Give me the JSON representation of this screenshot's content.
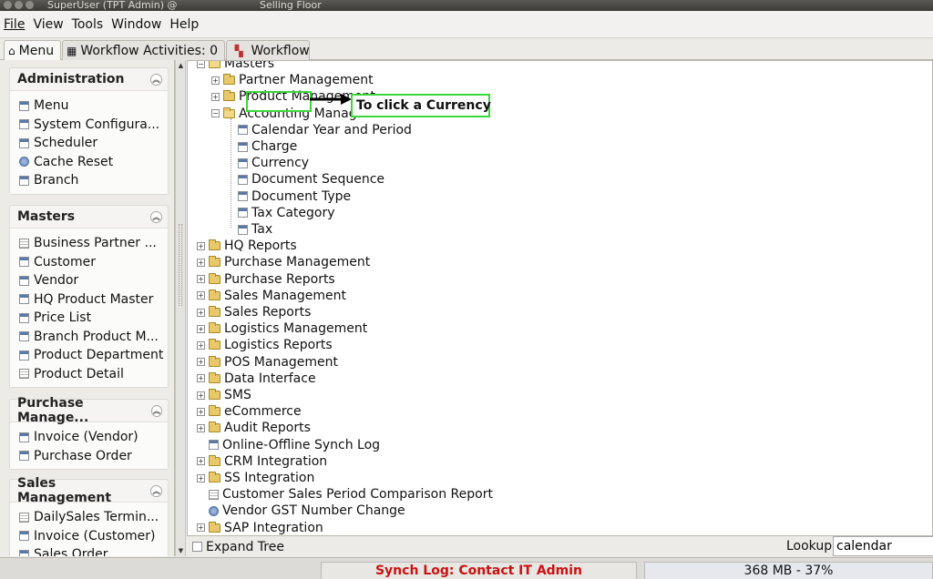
{
  "window": {
    "title": "SuperUser (TPT Admin) @",
    "title2": "Selling Floor"
  },
  "menubar": [
    "File",
    "View",
    "Tools",
    "Window",
    "Help"
  ],
  "tabs": [
    {
      "label": "Menu",
      "icon": "home-icon"
    },
    {
      "label": "Workflow Activities: 0",
      "icon": "table-icon"
    },
    {
      "label": "Workflow",
      "icon": "workflow-icon"
    }
  ],
  "sidebar": {
    "groups": [
      {
        "title": "Administration",
        "items": [
          {
            "label": "Menu",
            "icon": "window-icon"
          },
          {
            "label": "System Configura...",
            "icon": "window-icon"
          },
          {
            "label": "Scheduler",
            "icon": "window-icon"
          },
          {
            "label": "Cache Reset",
            "icon": "process-icon"
          },
          {
            "label": "Branch",
            "icon": "window-icon"
          }
        ]
      },
      {
        "title": "Masters",
        "items": [
          {
            "label": "Business Partner ...",
            "icon": "report-icon"
          },
          {
            "label": "Customer",
            "icon": "window-icon"
          },
          {
            "label": "Vendor",
            "icon": "window-icon"
          },
          {
            "label": "HQ Product Master",
            "icon": "window-icon"
          },
          {
            "label": "Price List",
            "icon": "window-icon"
          },
          {
            "label": "Branch Product M...",
            "icon": "window-icon"
          },
          {
            "label": "Product Department",
            "icon": "window-icon"
          },
          {
            "label": "Product Detail",
            "icon": "report-icon"
          }
        ]
      },
      {
        "title": "Purchase Manage...",
        "items": [
          {
            "label": "Invoice (Vendor)",
            "icon": "window-icon"
          },
          {
            "label": "Purchase Order",
            "icon": "window-icon"
          }
        ]
      },
      {
        "title": "Sales Management",
        "items": [
          {
            "label": "DailySales Termin...",
            "icon": "report-icon"
          },
          {
            "label": "Invoice (Customer)",
            "icon": "window-icon"
          },
          {
            "label": "Sales Order",
            "icon": "window-icon"
          }
        ]
      }
    ]
  },
  "tree": {
    "nodes": [
      {
        "label": "Masters",
        "type": "folder-open",
        "expander": "−"
      },
      {
        "label": "Partner Management",
        "type": "folder",
        "expander": "+"
      },
      {
        "label": "Product Management",
        "type": "folder",
        "expander": "+"
      },
      {
        "label": "Accounting Management",
        "type": "folder-open",
        "expander": "−"
      },
      {
        "label": "Calendar Year and Period",
        "type": "window"
      },
      {
        "label": "Charge",
        "type": "window"
      },
      {
        "label": "Currency",
        "type": "window"
      },
      {
        "label": "Document Sequence",
        "type": "window"
      },
      {
        "label": "Document Type",
        "type": "window"
      },
      {
        "label": "Tax Category",
        "type": "window"
      },
      {
        "label": "Tax",
        "type": "window"
      },
      {
        "label": "HQ Reports",
        "type": "folder",
        "expander": "+"
      },
      {
        "label": "Purchase Management",
        "type": "folder",
        "expander": "+"
      },
      {
        "label": "Purchase Reports",
        "type": "folder",
        "expander": "+"
      },
      {
        "label": "Sales Management",
        "type": "folder",
        "expander": "+"
      },
      {
        "label": "Sales Reports",
        "type": "folder",
        "expander": "+"
      },
      {
        "label": "Logistics Management",
        "type": "folder",
        "expander": "+"
      },
      {
        "label": "Logistics Reports",
        "type": "folder",
        "expander": "+"
      },
      {
        "label": "POS Management",
        "type": "folder",
        "expander": "+"
      },
      {
        "label": "Data Interface",
        "type": "folder",
        "expander": "+"
      },
      {
        "label": "SMS",
        "type": "folder",
        "expander": "+"
      },
      {
        "label": "eCommerce",
        "type": "folder",
        "expander": "+"
      },
      {
        "label": "Audit Reports",
        "type": "folder",
        "expander": "+"
      },
      {
        "label": "Online-Offline Synch Log",
        "type": "window"
      },
      {
        "label": "CRM Integration",
        "type": "folder",
        "expander": "+"
      },
      {
        "label": "SS Integration",
        "type": "folder",
        "expander": "+"
      },
      {
        "label": "Customer Sales Period Comparison Report",
        "type": "report"
      },
      {
        "label": "Vendor GST Number Change",
        "type": "process"
      },
      {
        "label": "SAP Integration",
        "type": "folder",
        "expander": "+"
      }
    ]
  },
  "annotation": {
    "callout": "To click a Currency",
    "highlight_color": "#3bd63b"
  },
  "bottom": {
    "expand_tree": "Expand Tree",
    "lookup_label": "Lookup",
    "lookup_value": "calendar"
  },
  "status": {
    "synch": "Synch Log: Contact IT Admin",
    "memory": "368 MB - 37%",
    "synch_color": "#cc1111"
  }
}
